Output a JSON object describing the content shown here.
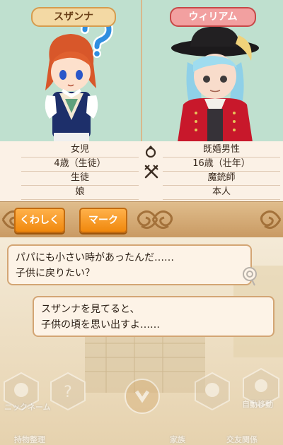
{
  "left_character": {
    "name": "スザンナ"
  },
  "right_character": {
    "name": "ウィリアム"
  },
  "left_info": [
    "女児",
    "4歳（生徒）",
    "生徒",
    "娘"
  ],
  "right_info": [
    "既婚男性",
    "16歳（壮年）",
    "魔銃師",
    "本人"
  ],
  "toolbar": {
    "detail_label": "くわしく",
    "mark_label": "マーク"
  },
  "dialogue": {
    "bubble1": [
      "パパにも小さい時があったんだ……",
      "子供に戻りたい？"
    ],
    "bubble2": [
      "スザンナを見てると、",
      "子供の頃を思い出すよ……"
    ]
  },
  "hud": {
    "label_top_left": "ニックネーム",
    "label_top_right": "自動移動",
    "label_bottom_left": "持物整理",
    "label_bottom_mid": "家族",
    "label_bottom_mid2": "交友関係"
  },
  "icons": [
    "question-mark-icon",
    "ring-icon",
    "crossed-swords-icon",
    "ornament-icon",
    "advance-icon"
  ]
}
